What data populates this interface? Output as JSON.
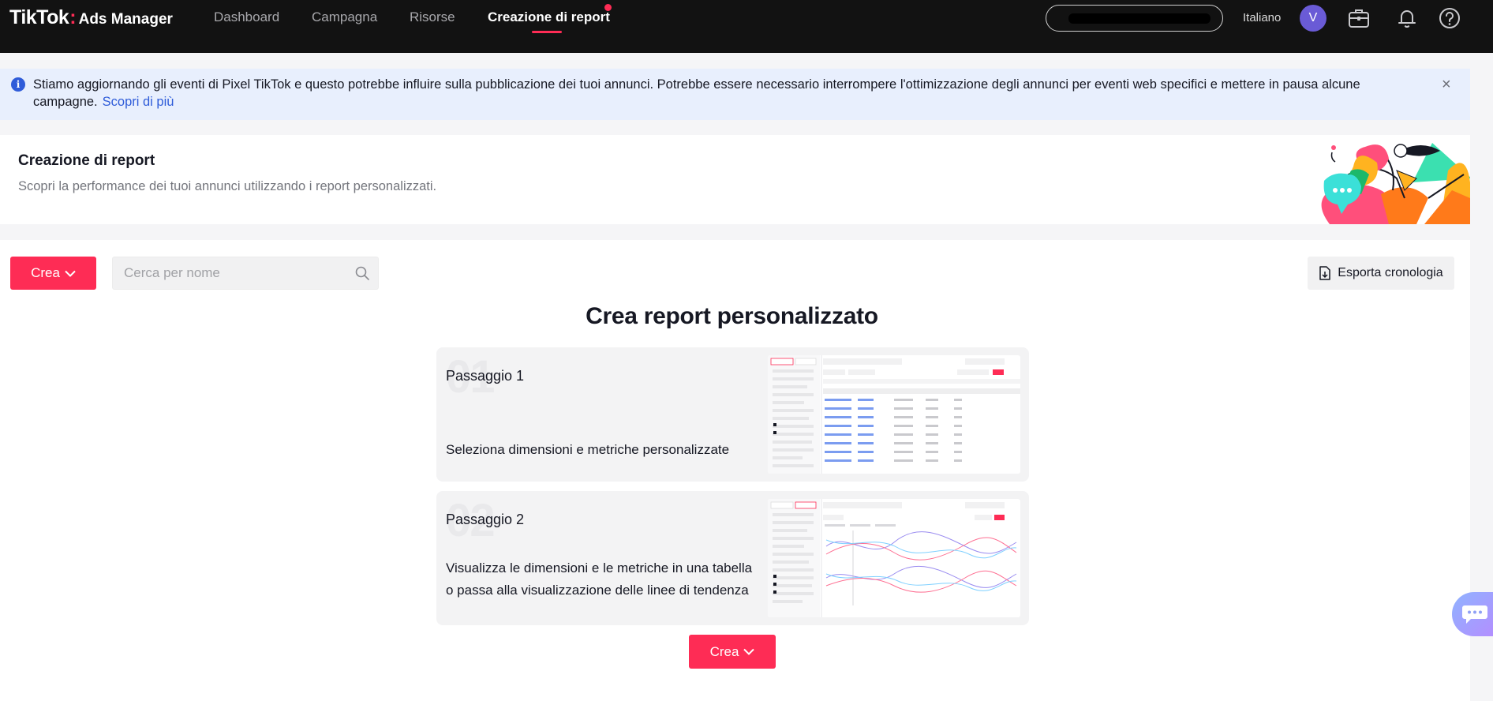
{
  "brand": {
    "name": "TikTok",
    "colon": ":",
    "product": "Ads Manager"
  },
  "nav": {
    "items": [
      {
        "label": "Dashboard"
      },
      {
        "label": "Campagna"
      },
      {
        "label": "Risorse"
      },
      {
        "label": "Creazione di report",
        "active": true
      }
    ]
  },
  "topbar": {
    "language": "Italiano",
    "avatar_initial": "V"
  },
  "notice": {
    "text": "Stiamo aggiornando gli eventi di Pixel TikTok e questo potrebbe influire sulla pubblicazione dei tuoi annunci. Potrebbe essere necessario interrompere l'ottimizzazione degli annunci per eventi web specifici e mettere in pausa alcune campagne.",
    "link": "Scopri di più",
    "close": "×",
    "info_glyph": "i"
  },
  "header": {
    "title": "Creazione di report",
    "subtitle": "Scopri la performance dei tuoi annunci utilizzando i report personalizzati."
  },
  "toolbar": {
    "create_label": "Crea",
    "search_placeholder": "Cerca per nome",
    "export_label": "Esporta cronologia"
  },
  "main": {
    "title": "Crea report personalizzato",
    "steps": [
      {
        "number": "01",
        "title": "Passaggio 1",
        "description": "Seleziona dimensioni e metriche personalizzate"
      },
      {
        "number": "02",
        "title": "Passaggio 2",
        "description": "Visualizza le dimensioni e le metriche in una tabella o passa alla visualizzazione delle linee di tendenza"
      }
    ],
    "bottom_create_label": "Crea"
  },
  "colors": {
    "accent": "#fe2c55",
    "link": "#2f5cd9",
    "topbar": "#121212",
    "notice_bg": "#e8effd"
  }
}
